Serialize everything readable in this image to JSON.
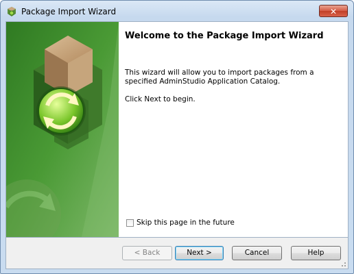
{
  "window": {
    "title": "Package Import Wizard",
    "close_label": "✕"
  },
  "main": {
    "heading": "Welcome to the Package Import Wizard",
    "description": "This wizard will allow you to import packages from a specified AdminStudio Application Catalog.",
    "hint": "Click Next to begin.",
    "skip_checkbox": {
      "label": "Skip this page in the future",
      "checked": false
    }
  },
  "buttons": {
    "back": "< Back",
    "next": "Next >",
    "cancel": "Cancel",
    "help": "Help"
  },
  "icons": [
    "app-icon",
    "close-icon",
    "package-box-icon",
    "refresh-arrows-icon",
    "resize-grip-icon"
  ],
  "colors": {
    "banner_green": "#3d8a2c",
    "title_bg": "#c9dcf0",
    "close_red": "#c94a35"
  }
}
